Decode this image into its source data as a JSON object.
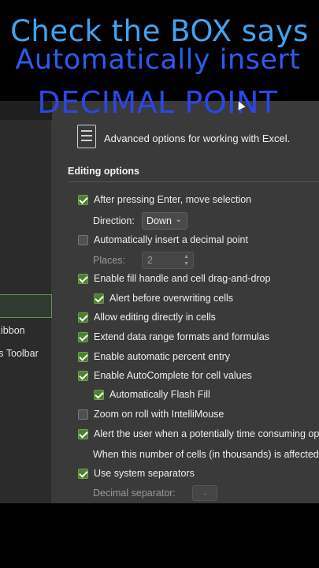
{
  "overlay": {
    "line1": "Check the BOX says",
    "line2": "Automatically insert",
    "line3": "DECIMAL POINT"
  },
  "sidebar": {
    "items": [
      {
        "label": "y",
        "selected": false
      },
      {
        "label": "",
        "selected": true
      },
      {
        "label": "Ribbon",
        "selected": false
      },
      {
        "label": "ss Toolbar",
        "selected": false
      },
      {
        "label": "r",
        "selected": false
      }
    ]
  },
  "panel": {
    "header": "Advanced options for working with Excel.",
    "section": "Editing options",
    "after_enter": "After pressing Enter, move selection",
    "direction_label": "Direction:",
    "direction_value": "Down",
    "auto_decimal": "Automatically insert a decimal point",
    "places_label": "Places:",
    "places_value": "2",
    "fill_handle": "Enable fill handle and cell drag-and-drop",
    "alert_overwrite": "Alert before overwriting cells",
    "allow_editing": "Allow editing directly in cells",
    "extend_formats": "Extend data range formats and formulas",
    "auto_percent": "Enable automatic percent entry",
    "autocomplete": "Enable AutoComplete for cell values",
    "flash_fill": "Automatically Flash Fill",
    "zoom_roll": "Zoom on roll with IntelliMouse",
    "alert_time": "Alert the user when a potentially time consuming ope",
    "cells_affected": "When this number of cells (in thousands) is affected:",
    "system_separators": "Use system separators",
    "decimal_separator_label": "Decimal separator:",
    "decimal_separator_value": "."
  },
  "colors": {
    "check_green": "#4e7d33",
    "overlay_blue": "#2b5bf0"
  }
}
